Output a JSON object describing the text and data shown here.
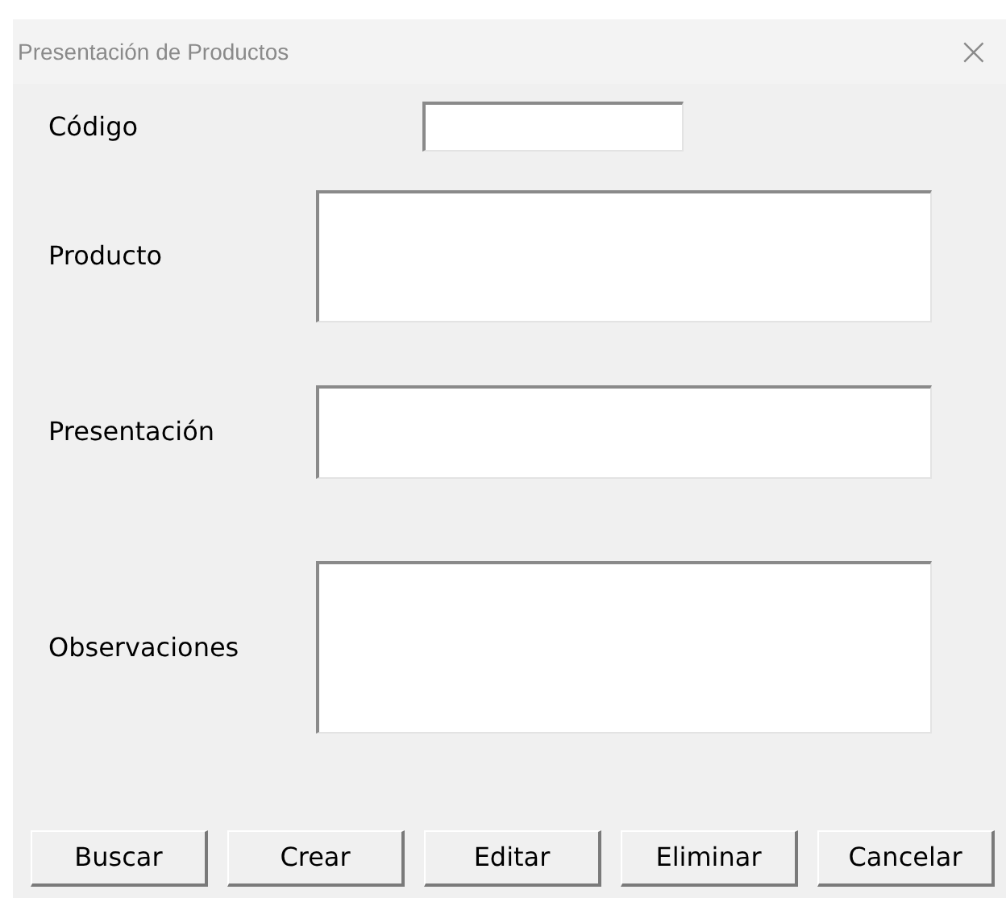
{
  "window": {
    "title": "Presentación de Productos",
    "close": "×"
  },
  "fields": [
    {
      "label": "Código",
      "kind": "short"
    },
    {
      "label": "Producto",
      "kind": "box"
    },
    {
      "label": "Presentación",
      "kind": "box"
    },
    {
      "label": "Observaciones",
      "kind": "box"
    }
  ],
  "buttons": [
    "Buscar",
    "Crear",
    "Editar",
    "Eliminar",
    "Cancelar"
  ]
}
